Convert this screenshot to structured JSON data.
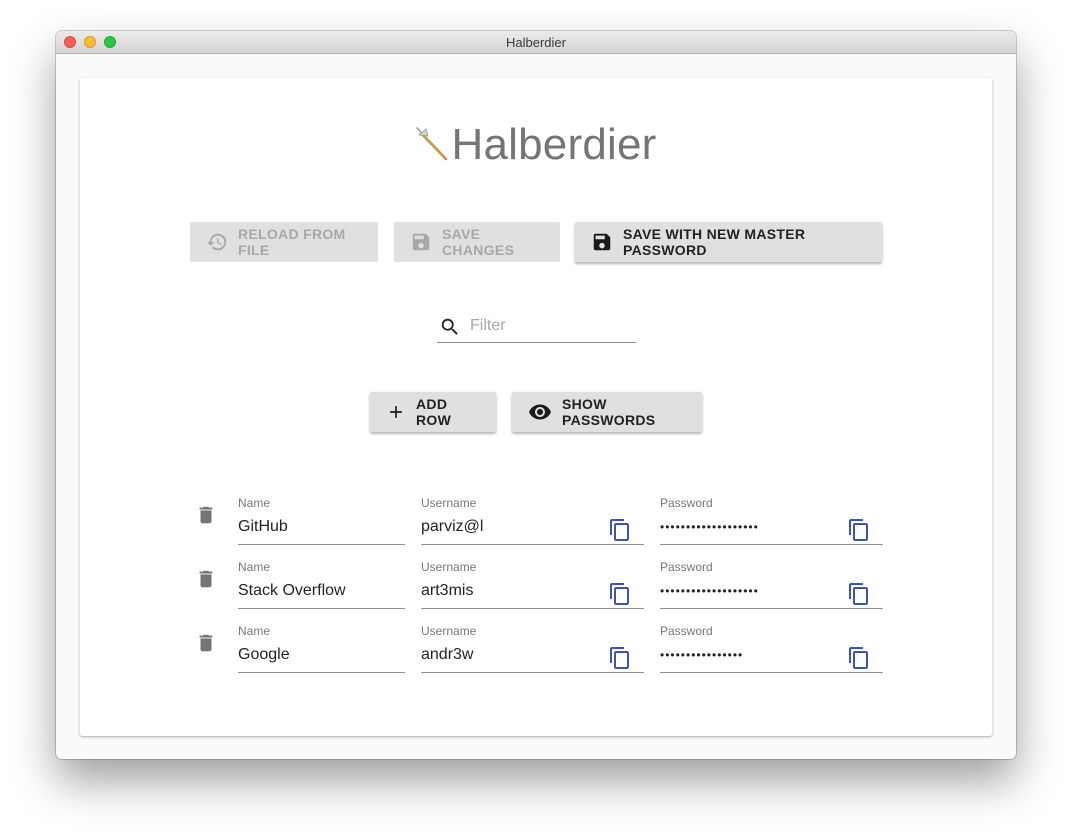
{
  "window": {
    "title": "Halberdier"
  },
  "app": {
    "name": "Halberdier",
    "logo_icon": "halberd-icon"
  },
  "toolbar": {
    "reload_label": "Reload from file",
    "reload_icon": "history-icon",
    "save_label": "Save changes",
    "save_icon": "floppy-disk-icon",
    "save_master_label": "Save with new master password",
    "save_master_icon": "floppy-disk-icon"
  },
  "filter": {
    "placeholder": "Filter",
    "value": "",
    "icon": "search-icon"
  },
  "actions": {
    "add_row_label": "Add row",
    "add_row_icon": "plus-icon",
    "show_passwords_label": "Show passwords",
    "show_passwords_icon": "eye-icon"
  },
  "labels": {
    "name": "Name",
    "username": "Username",
    "password": "Password"
  },
  "entries": [
    {
      "name": "GitHub",
      "username": "parviz@l",
      "password": "•••••••••••••••••••"
    },
    {
      "name": "Stack Overflow",
      "username": "art3mis",
      "password": "•••••••••••••••••••"
    },
    {
      "name": "Google",
      "username": "andr3w",
      "password": "••••••••••••••••"
    }
  ],
  "colors": {
    "copy_icon": "#3f51b5",
    "icon_gray": "#757575",
    "disabled_text": "#a8a8a8"
  }
}
